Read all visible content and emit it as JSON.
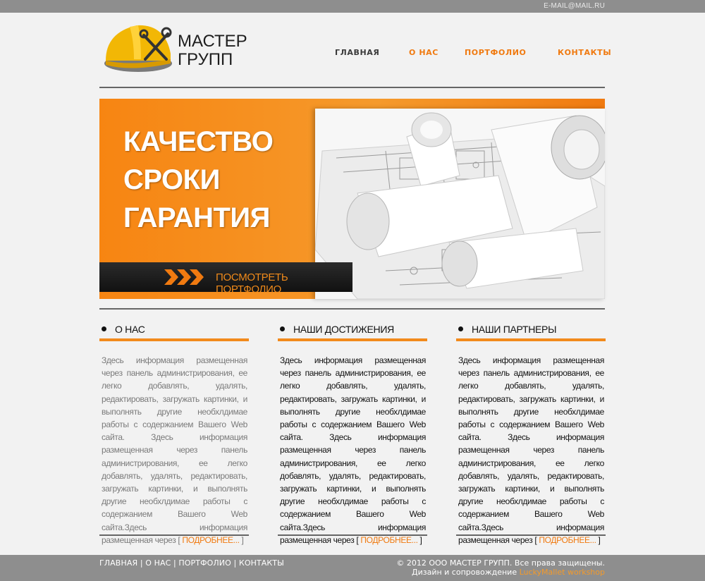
{
  "topbar": {
    "email": "E-MAIL@MAIL.RU"
  },
  "logo": {
    "line1": "МАСТЕР",
    "line2": "ГРУПП",
    "icon": "hardhat-wrench-icon"
  },
  "nav": [
    {
      "label": "ГЛАВНАЯ"
    },
    {
      "label": "О НАС"
    },
    {
      "label": "ПОРТФОЛИО"
    },
    {
      "label": "КОНТАКТЫ"
    }
  ],
  "banner": {
    "slogan": [
      "КАЧЕСТВО",
      "СРОКИ",
      "ГАРАНТИЯ"
    ],
    "button": "ПОСМОТРЕТЬ ПОРТФОЛИО",
    "image": "blueprints-rolls-image"
  },
  "columns": [
    {
      "title": "О НАС",
      "text": "Здесь информация размещенная через панель администрирования, ее легко добавлять, удалять, редактировать, загружать картинки, и выполнять другие необхлдимае работы с содержанием Вашего Web сайта. Здесь информация размещенная через панель администрирования, ее легко добавлять, удалять, редактировать, загружать картинки, и выполнять другие необхлдимае работы с содержанием Вашего Web сайта.Здесь информация размещенная через",
      "more": "ПОДРОБНЕЕ...",
      "color": "#7a7a7a"
    },
    {
      "title": "НАШИ ДОСТИЖЕНИЯ",
      "text": "Здесь информация размещенная через панель администрирования, ее легко добавлять, удалять, редактировать, загружать картинки, и выполнять другие необхлдимае работы с содержанием Вашего Web сайта. Здесь информация размещенная через панель администрирования, ее легко добавлять, удалять, редактировать, загружать картинки, и выполнять другие необхлдимае работы с содержанием Вашего Web сайта.Здесь информация размещенная через",
      "more": "ПОДРОБНЕЕ...",
      "color": "#111111"
    },
    {
      "title": "НАШИ ПАРТНЕРЫ",
      "text": "Здесь информация размещенная через панель администрирования, ее легко добавлять, удалять, редактировать, загружать картинки, и выполнять другие необхлдимае работы с содержанием Вашего Web сайта. Здесь информация размещенная через панель администрирования, ее легко добавлять, удалять, редактировать, загружать картинки, и выполнять другие необхлдимае работы с содержанием Вашего Web сайта.Здесь информация размещенная через",
      "more": "ПОДРОБНЕЕ...",
      "color": "#111111"
    }
  ],
  "footer": {
    "links": [
      "ГЛАВНАЯ",
      "О НАС",
      "ПОРТФОЛИО",
      "КОНТАКТЫ"
    ],
    "separator": "|",
    "copyright": "© 2012 ООО МАСТЕР ГРУПП. Все права защищены.",
    "design_prefix": "Дизайн и сопровождение",
    "studio": "LuckyMallet workshop"
  },
  "colors": {
    "accent": "#f07a10",
    "bar": "#8e8e8e",
    "background": "#f2f2f2"
  }
}
